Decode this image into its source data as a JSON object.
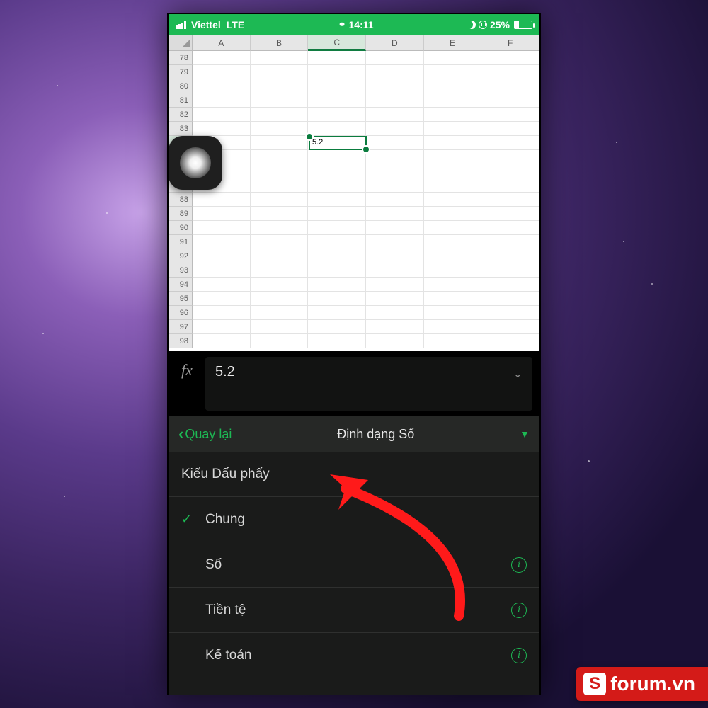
{
  "statusbar": {
    "carrier": "Viettel",
    "network": "LTE",
    "time": "14:11",
    "battery_pct": "25%"
  },
  "sheet": {
    "columns": [
      "A",
      "B",
      "C",
      "D",
      "E",
      "F"
    ],
    "selected_col_index": 2,
    "row_start": 78,
    "row_end": 98,
    "selected_row": 84,
    "selected_cell_value": "5.2"
  },
  "formula_bar": {
    "fx_symbol": "fx",
    "value": "5.2"
  },
  "panel": {
    "back_label": "Quay lại",
    "title": "Định dạng Số",
    "section_header": "Kiểu Dấu phẩy",
    "options": [
      {
        "label": "Chung",
        "checked": true,
        "info": false
      },
      {
        "label": "Số",
        "checked": false,
        "info": true
      },
      {
        "label": "Tiền tệ",
        "checked": false,
        "info": true
      },
      {
        "label": "Kế toán",
        "checked": false,
        "info": true
      }
    ]
  },
  "watermark": {
    "logo_letter": "S",
    "text": "forum.vn"
  }
}
